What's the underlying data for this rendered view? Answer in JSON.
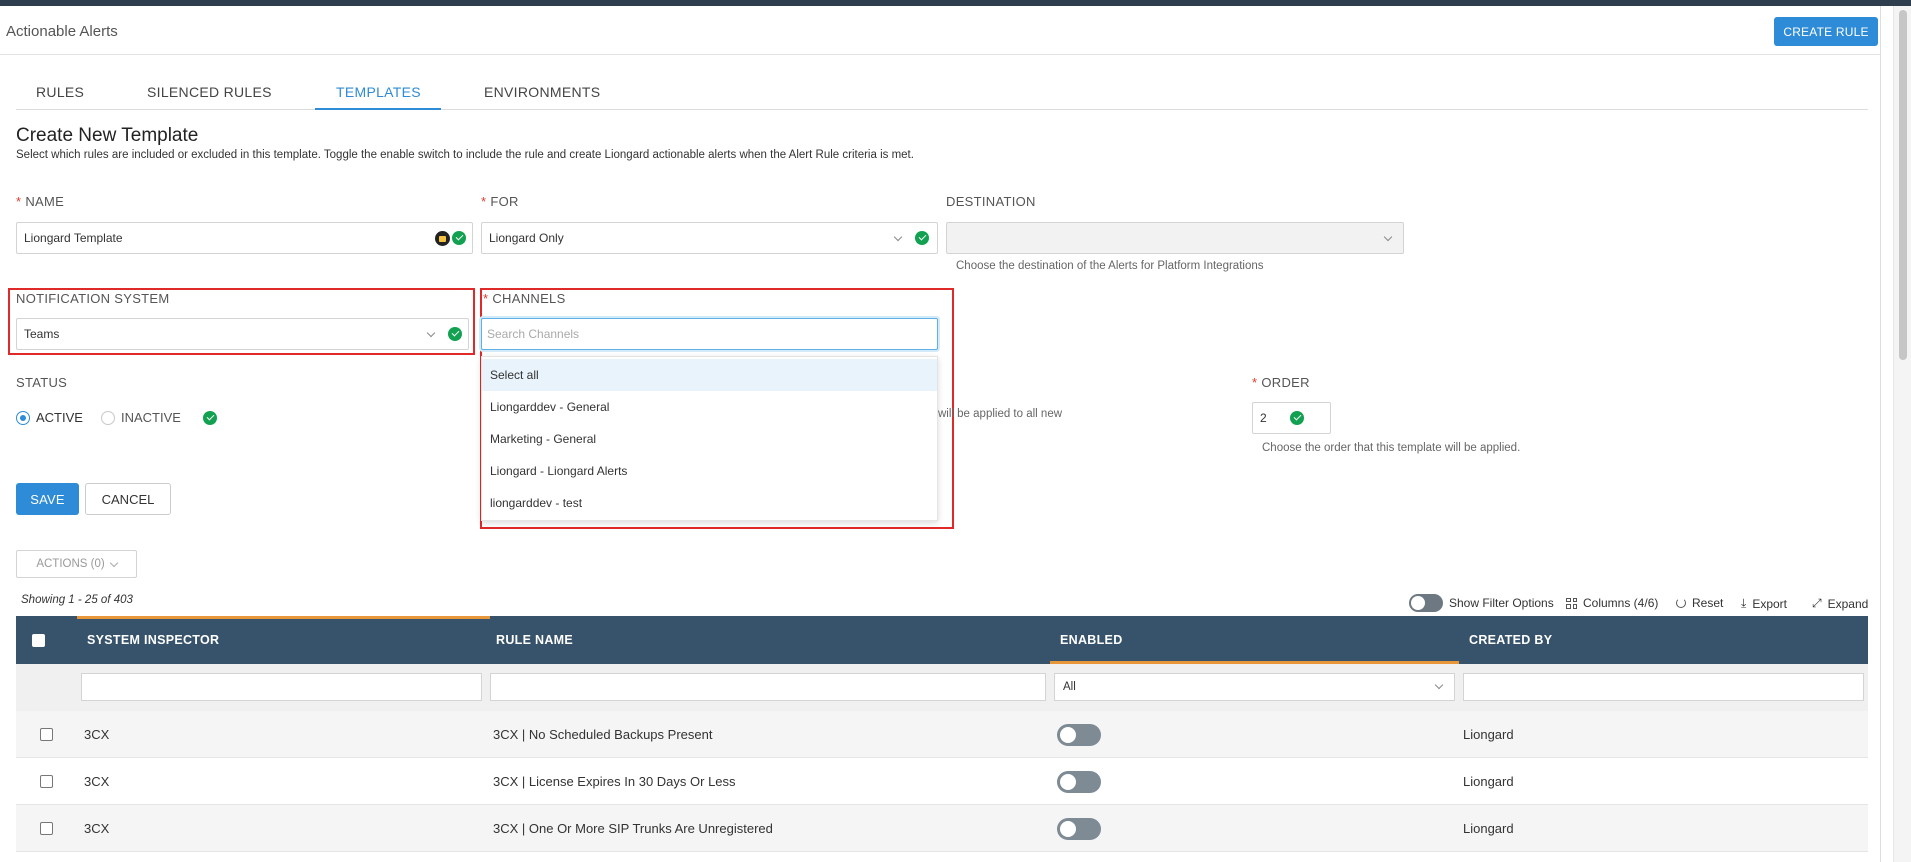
{
  "header": {
    "title": "Actionable Alerts",
    "create_rule": "CREATE RULE"
  },
  "tabs": [
    {
      "label": "RULES"
    },
    {
      "label": "SILENCED RULES"
    },
    {
      "label": "TEMPLATES"
    },
    {
      "label": "ENVIRONMENTS"
    }
  ],
  "active_tab": "TEMPLATES",
  "form": {
    "title": "Create New Template",
    "description": "Select which rules are included or excluded in this template. Toggle the enable switch to include the rule and create Liongard actionable alerts when the Alert Rule criteria is met.",
    "name": {
      "label": "NAME",
      "value": "Liongard Template"
    },
    "for": {
      "label": "FOR",
      "value": "Liongard Only"
    },
    "destination": {
      "label": "DESTINATION",
      "value": "",
      "hint": "Choose the destination of the Alerts for Platform Integrations"
    },
    "notification_system": {
      "label": "NOTIFICATION SYSTEM",
      "value": "Teams"
    },
    "channels": {
      "label": "CHANNELS",
      "placeholder": "Search Channels",
      "options": [
        "Select all",
        "Liongarddev - General",
        "Marketing - General",
        "Liongard - Liongard Alerts",
        "liongarddev - test"
      ]
    },
    "status": {
      "label": "STATUS",
      "active": "ACTIVE",
      "inactive": "INACTIVE",
      "selected": "ACTIVE"
    },
    "partial_hint": "will be applied to all new",
    "order": {
      "label": "ORDER",
      "value": "2",
      "hint": "Choose the order that this template will be applied."
    },
    "save": "SAVE",
    "cancel": "CANCEL"
  },
  "actions": {
    "label": "ACTIONS (0)"
  },
  "table": {
    "showing": "Showing 1 - 25 of 403",
    "toolbar": {
      "show_filter": "Show Filter Options",
      "columns": "Columns (4/6)",
      "reset": "Reset",
      "export": "Export",
      "expand": "Expand"
    },
    "columns": [
      "SYSTEM INSPECTOR",
      "RULE NAME",
      "ENABLED",
      "CREATED BY"
    ],
    "enabled_filter": "All",
    "rows": [
      {
        "inspector": "3CX",
        "rule": "3CX | No Scheduled Backups Present",
        "created_by": "Liongard"
      },
      {
        "inspector": "3CX",
        "rule": "3CX | License Expires In 30 Days Or Less",
        "created_by": "Liongard"
      },
      {
        "inspector": "3CX",
        "rule": "3CX | One Or More SIP Trunks Are Unregistered",
        "created_by": "Liongard"
      }
    ]
  },
  "colors": {
    "accent": "#2e8bd7",
    "header_bg": "#37536b",
    "success": "#12a150",
    "highlight_border": "#e02a2a",
    "sort_bar": "#e8963a"
  }
}
